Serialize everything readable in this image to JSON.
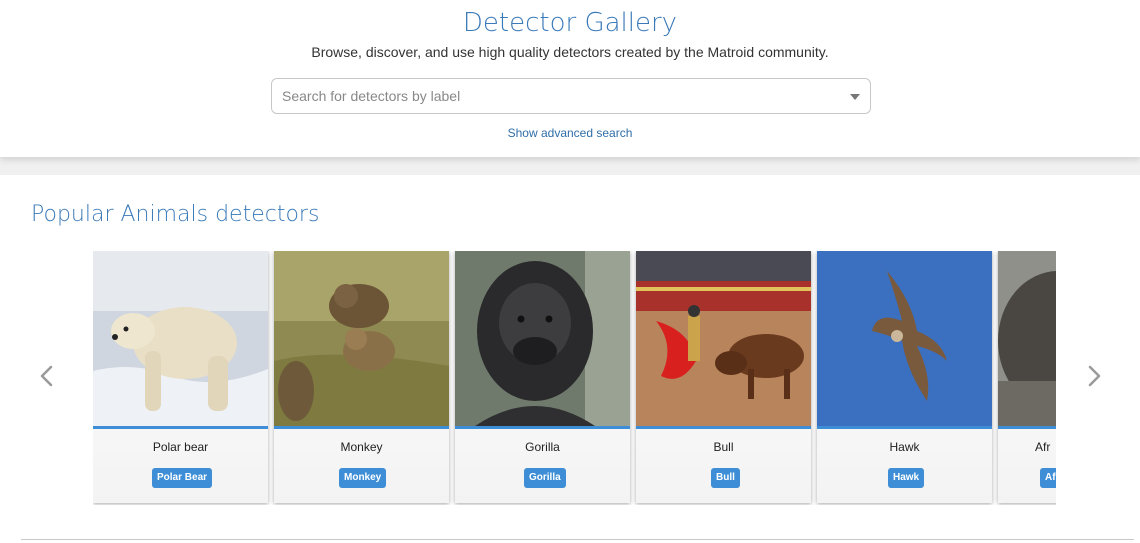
{
  "header": {
    "title": "Detector Gallery",
    "subtitle": "Browse, discover, and use high quality detectors created by the Matroid community.",
    "search_placeholder": "Search for detectors by label",
    "advanced_link": "Show advanced search"
  },
  "section": {
    "title": "Popular Animals detectors",
    "prev_icon": "chevron-left-icon",
    "next_icon": "chevron-right-icon"
  },
  "detectors": [
    {
      "name": "Polar bear",
      "label": "Polar Bear"
    },
    {
      "name": "Monkey",
      "label": "Monkey"
    },
    {
      "name": "Gorilla",
      "label": "Gorilla"
    },
    {
      "name": "Bull",
      "label": "Bull"
    },
    {
      "name": "Hawk",
      "label": "Hawk"
    },
    {
      "name": "Afr",
      "label": "Af"
    }
  ],
  "colors": {
    "accent": "#3a7ab8",
    "badge": "#3d8ed6",
    "link": "#2f6ea8"
  }
}
